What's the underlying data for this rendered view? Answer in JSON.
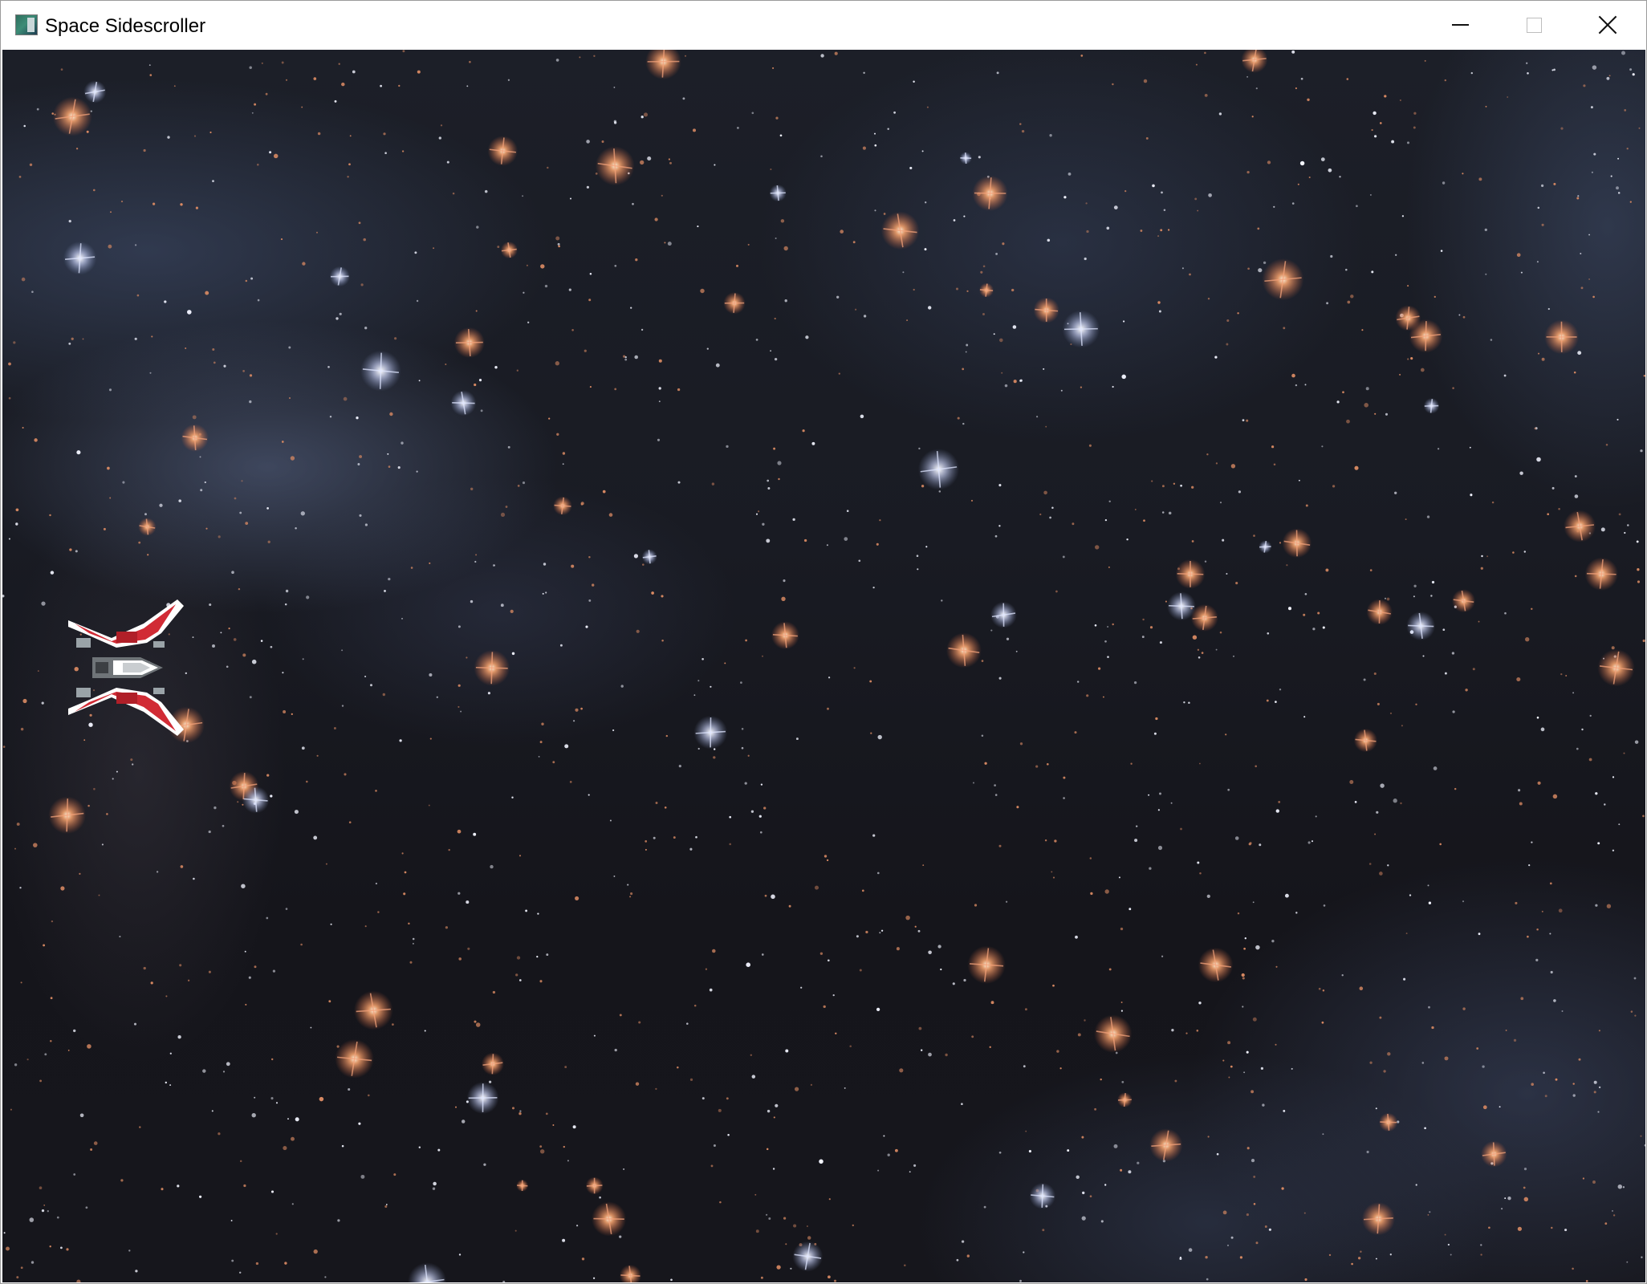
{
  "window": {
    "title": "Space Sidescroller",
    "icon": "app-icon",
    "controls": [
      "minimize-icon",
      "maximize-icon",
      "close-icon"
    ]
  },
  "game": {
    "background": "starfield-nebula",
    "player": "player-ship"
  },
  "colors": {
    "space_dark": "#16161c",
    "nebula_blue": "#5c6a8c",
    "star_orange": "#e0875a",
    "star_white": "#ffffff",
    "ship_red": "#d12b35",
    "ship_white": "#ffffff"
  }
}
